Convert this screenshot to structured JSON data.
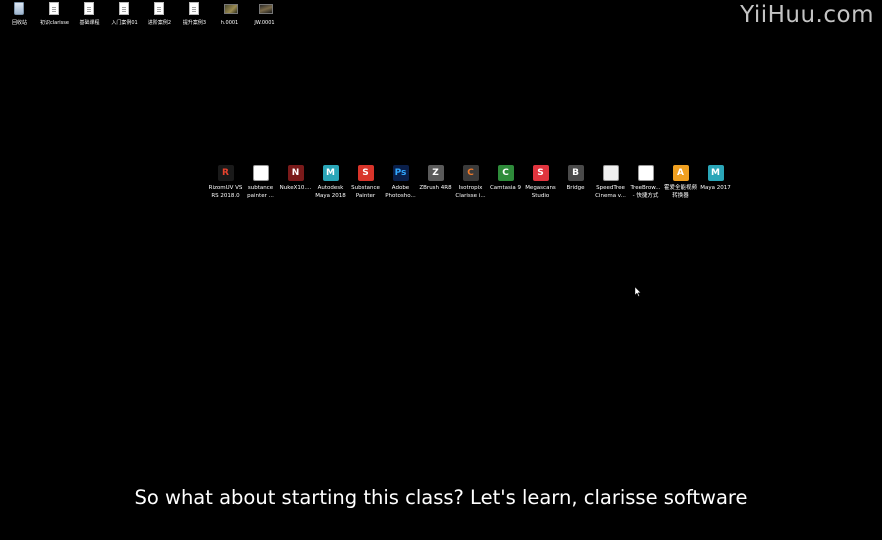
{
  "watermark": "YiiHuu.com",
  "subtitle": "So what about starting this class? Let's learn, clarisse software",
  "top_icons": [
    {
      "label": "回收站",
      "icon": "recycle-bin-icon"
    },
    {
      "label": "初识clarisse",
      "icon": "document-icon"
    },
    {
      "label": "基础课程",
      "icon": "document-icon"
    },
    {
      "label": "入门案例01",
      "icon": "document-icon"
    },
    {
      "label": "进阶案例2",
      "icon": "document-icon"
    },
    {
      "label": "提升案例3",
      "icon": "document-icon"
    },
    {
      "label": "h.0001",
      "icon": "image-thumbnail-icon"
    },
    {
      "label": "JW.0001",
      "icon": "image-thumbnail-icon"
    }
  ],
  "app_icons": [
    {
      "line1": "RizomUV VS",
      "line2": "RS 2018.0",
      "icon": "rizomuv-icon",
      "glyph": "R",
      "color": "#1a1a1a",
      "fg": "#e8432e"
    },
    {
      "line1": "subtance",
      "line2": "painter ...",
      "icon": "shortcut-file-icon",
      "glyph": "",
      "color": "#ffffff",
      "fg": "#333333"
    },
    {
      "line1": "NukeX10....",
      "line2": "",
      "icon": "nukex-icon",
      "glyph": "N",
      "color": "#7a1a1a",
      "fg": "#ffffff"
    },
    {
      "line1": "Autodesk",
      "line2": "Maya 2018",
      "icon": "maya-2018-icon",
      "glyph": "M",
      "color": "#2aa6b8",
      "fg": "#ffffff"
    },
    {
      "line1": "Substance",
      "line2": "Painter",
      "icon": "substance-painter-icon",
      "glyph": "S",
      "color": "#d8342a",
      "fg": "#ffffff"
    },
    {
      "line1": "Adobe",
      "line2": "Photosho...",
      "icon": "photoshop-icon",
      "glyph": "Ps",
      "color": "#0a1f4a",
      "fg": "#31a8ff"
    },
    {
      "line1": "ZBrush 4R8",
      "line2": "",
      "icon": "zbrush-icon",
      "glyph": "Z",
      "color": "#5a5a5a",
      "fg": "#ffffff"
    },
    {
      "line1": "Isotropix",
      "line2": "Clarisse i...",
      "icon": "clarisse-icon",
      "glyph": "C",
      "color": "#3a3a3a",
      "fg": "#f07a2a"
    },
    {
      "line1": "Camtasia 9",
      "line2": "",
      "icon": "camtasia-icon",
      "glyph": "C",
      "color": "#2e8b3a",
      "fg": "#ffffff"
    },
    {
      "line1": "Megascans",
      "line2": "Studio",
      "icon": "megascans-icon",
      "glyph": "S",
      "color": "#e0343e",
      "fg": "#ffffff"
    },
    {
      "line1": "Bridge",
      "line2": "",
      "icon": "bridge-icon",
      "glyph": "B",
      "color": "#4a4a4a",
      "fg": "#ffffff"
    },
    {
      "line1": "SpeedTree",
      "line2": "Cinema v...",
      "icon": "speedtree-icon",
      "glyph": "",
      "color": "#f0f0f0",
      "fg": "#5a8a2a"
    },
    {
      "line1": "TreeBrow...",
      "line2": "- 快捷方式",
      "icon": "treebrowser-icon",
      "glyph": "",
      "color": "#ffffff",
      "fg": "#444444"
    },
    {
      "line1": "霍爱全能视频",
      "line2": "转换器",
      "icon": "video-converter-icon",
      "glyph": "A",
      "color": "#f0a020",
      "fg": "#ffffff"
    },
    {
      "line1": "Maya 2017",
      "line2": "",
      "icon": "maya-2017-icon",
      "glyph": "M",
      "color": "#2aa6b8",
      "fg": "#ffffff"
    }
  ]
}
